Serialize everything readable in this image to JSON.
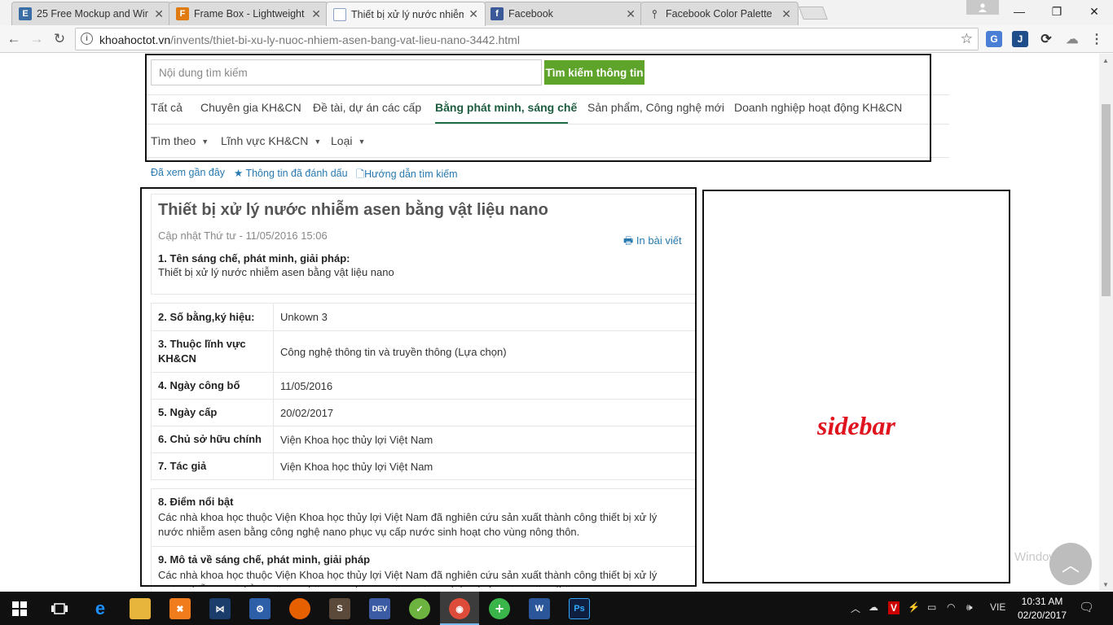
{
  "browser": {
    "tabs": [
      {
        "title": "25 Free Mockup and Wir",
        "favicon": "letter-E-icon",
        "favicon_color": "#3a6ea5",
        "favicon_text": "E"
      },
      {
        "title": "Frame Box - Lightweight",
        "favicon": "letter-F-icon",
        "favicon_color": "#e07b12",
        "favicon_text": "F"
      },
      {
        "title": "Thiết bị xử lý nước nhiễm",
        "favicon": "page-icon",
        "favicon_color": "#8aa2c8",
        "favicon_text": ""
      },
      {
        "title": "Facebook",
        "favicon": "facebook-icon",
        "favicon_color": "#3b5998",
        "favicon_text": "f"
      },
      {
        "title": "Facebook Color Palette",
        "favicon": "pin-icon",
        "favicon_color": "#555555",
        "favicon_text": ""
      }
    ],
    "active_tab_index": 2,
    "url_host": "khoahoctot.vn",
    "url_path": "/invents/thiet-bi-xu-ly-nuoc-nhiem-asen-bang-vat-lieu-nano-3442.html"
  },
  "search": {
    "placeholder": "Nội dung tìm kiếm",
    "button_label": "Tìm kiếm thông tin"
  },
  "nav_tabs": [
    "Tất cả",
    "Chuyên gia KH&CN",
    "Đề tài, dự án các cấp",
    "Bằng phát minh, sáng chế",
    "Sản phẩm, Công nghệ mới",
    "Doanh nghiệp hoạt động KH&CN"
  ],
  "active_nav_index": 3,
  "filters": [
    "Tìm theo",
    "Lĩnh vực KH&CN",
    "Loại"
  ],
  "quick_links": [
    "Đã xem gần đây",
    "Thông tin đã đánh dấu",
    "Hướng dẫn tìm kiếm"
  ],
  "article": {
    "title": "Thiết bị xử lý nước nhiễm asen bằng vật liệu nano",
    "updated": "Cập nhật Thứ tư - 11/05/2016 15:06",
    "print_label": "In bài viết",
    "section1_title": "1. Tên sáng chế, phát minh, giải pháp:",
    "section1_text": "Thiết bị xử lý nước nhiễm asen bằng vật liệu nano",
    "rows": [
      {
        "label": "2. Số bằng,ký hiệu:",
        "value": "Unkown 3"
      },
      {
        "label": "3. Thuộc lĩnh vực KH&CN",
        "value": "Công nghệ thông tin và truyền thông (Lựa chọn)"
      },
      {
        "label": "4. Ngày công bố",
        "value": "11/05/2016"
      },
      {
        "label": "5. Ngày cấp",
        "value": "20/02/2017"
      },
      {
        "label": "6. Chủ sở hữu chính",
        "value": "Viện Khoa học thủy lợi Việt Nam"
      },
      {
        "label": "7. Tác giả",
        "value": "Viện Khoa học thủy lợi Việt Nam"
      }
    ],
    "section8_title": "8. Điểm nổi bật",
    "section8_text": "Các nhà khoa học thuộc Viện Khoa học thủy lợi Việt Nam đã nghiên cứu sản xuất thành công thiết bị xử lý nước nhiễm asen bằng công nghệ nano phục vụ cấp nước sinh hoạt cho vùng nông thôn.",
    "section9_title": "9. Mô tả về sáng chế, phát minh, giải pháp",
    "section9_text": "Các nhà khoa học thuộc Viện Khoa học thủy lợi Việt Nam đã nghiên cứu sản xuất thành công thiết bị xử lý nước nhiễm asen bằng công nghệ nano phục vụ cấp nước sinh hoạt cho vùng nông thôn."
  },
  "sidebar": {
    "label": "sidebar",
    "label_color": "#e0141e"
  },
  "watermark": "Window",
  "taskbar": {
    "language": "VIE",
    "time": "10:31 AM",
    "date": "02/20/2017"
  }
}
